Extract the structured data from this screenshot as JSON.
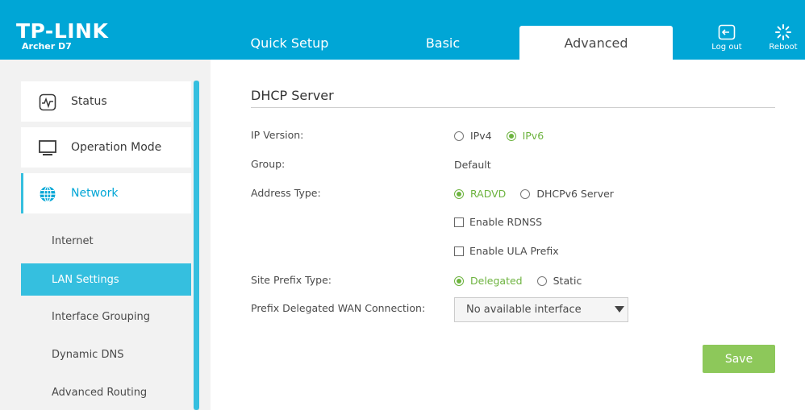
{
  "header": {
    "brand": "TP-LINK",
    "model": "Archer D7",
    "tabs": [
      {
        "label": "Quick Setup"
      },
      {
        "label": "Basic"
      },
      {
        "label": "Advanced"
      }
    ],
    "logout_label": "Log out",
    "reboot_label": "Reboot"
  },
  "sidebar": {
    "main_items": [
      {
        "label": "Status",
        "icon": "status-icon"
      },
      {
        "label": "Operation Mode",
        "icon": "monitor-icon"
      },
      {
        "label": "Network",
        "icon": "globe-icon"
      }
    ],
    "sub_items": [
      {
        "label": "Internet"
      },
      {
        "label": "LAN Settings"
      },
      {
        "label": "Interface Grouping"
      },
      {
        "label": "Dynamic DNS"
      },
      {
        "label": "Advanced Routing"
      }
    ]
  },
  "main": {
    "section_title": "DHCP Server",
    "fields": {
      "ip_version_label": "IP Version:",
      "ipv4_label": "IPv4",
      "ipv6_label": "IPv6",
      "group_label": "Group:",
      "group_value": "Default",
      "address_type_label": "Address Type:",
      "radvd_label": "RADVD",
      "dhcpv6_label": "DHCPv6 Server",
      "enable_rdnss_label": "Enable RDNSS",
      "enable_ula_label": "Enable ULA Prefix",
      "site_prefix_label": "Site Prefix Type:",
      "delegated_label": "Delegated",
      "static_label": "Static",
      "prefix_wan_label": "Prefix Delegated WAN Connection:",
      "prefix_wan_value": "No available interface"
    },
    "save_label": "Save"
  },
  "colors": {
    "header_blue": "#00a6d6",
    "accent_cyan": "#35bfdf",
    "selected_green": "#6db33f",
    "save_green": "#8dc85a"
  }
}
